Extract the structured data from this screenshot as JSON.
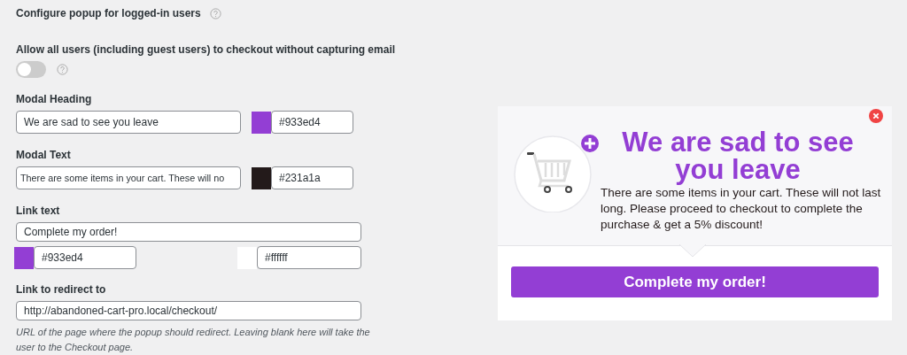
{
  "settings": {
    "logged_in_popup": {
      "label": "Configure popup for logged-in users"
    },
    "guest_checkout": {
      "label": "Allow all users (including guest users) to checkout without capturing email",
      "on": false
    },
    "modal_heading": {
      "label": "Modal Heading",
      "value": "We are sad to see you leave",
      "color": "#933ed4"
    },
    "modal_text": {
      "label": "Modal Text",
      "value": "There are some items in your cart. These will no",
      "color": "#231a1a"
    },
    "link_text": {
      "label": "Link text",
      "value": "Complete my order!",
      "bg_color": "#933ed4",
      "text_color": "#ffffff"
    },
    "redirect": {
      "label": "Link to redirect to",
      "value": "http://abandoned-cart-pro.local/checkout/",
      "description": "URL of the page where the popup should redirect. Leaving blank here will take the user to the Checkout page."
    }
  },
  "preview": {
    "heading": "We are sad to see you leave",
    "text": "There are some items in your cart. These will not last long. Please proceed to checkout to complete the purchase & get a 5% discount!",
    "button": "Complete my order!"
  }
}
